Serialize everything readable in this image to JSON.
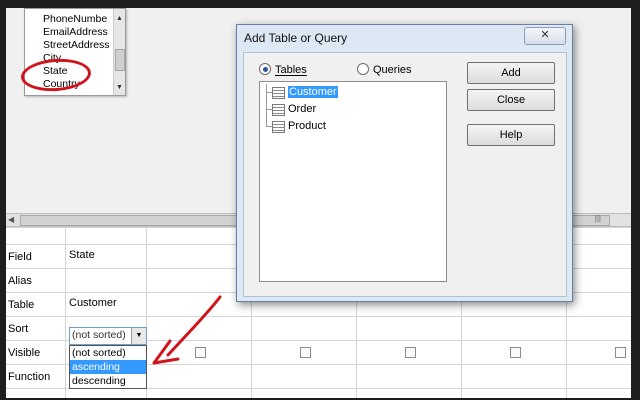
{
  "field_list": {
    "items": [
      "PhoneNumbe",
      "EmailAddress",
      "StreetAddress",
      "City",
      "State",
      "Country"
    ]
  },
  "grid": {
    "row_labels": [
      "Field",
      "Alias",
      "Table",
      "Sort",
      "Visible",
      "Function"
    ],
    "field_value": "State",
    "table_value": "Customer",
    "sort_value": "(not sorted)",
    "sort_options": [
      "(not sorted)",
      "ascending",
      "descending"
    ],
    "highlighted_option": "ascending"
  },
  "dialog": {
    "title": "Add Table or Query",
    "close_label": "✕",
    "radio_tables": "Tables",
    "radio_queries": "Queries",
    "selected_radio": "Tables",
    "items": [
      "Customer",
      "Order",
      "Product"
    ],
    "selected_item": "Customer",
    "buttons": {
      "add": "Add",
      "close": "Close",
      "help": "Help"
    }
  },
  "scrollbar": {
    "grip": "|||"
  },
  "colors": {
    "selection": "#3399ff",
    "annotation": "#d0141c",
    "dialog_frame": "#dde8f5"
  }
}
